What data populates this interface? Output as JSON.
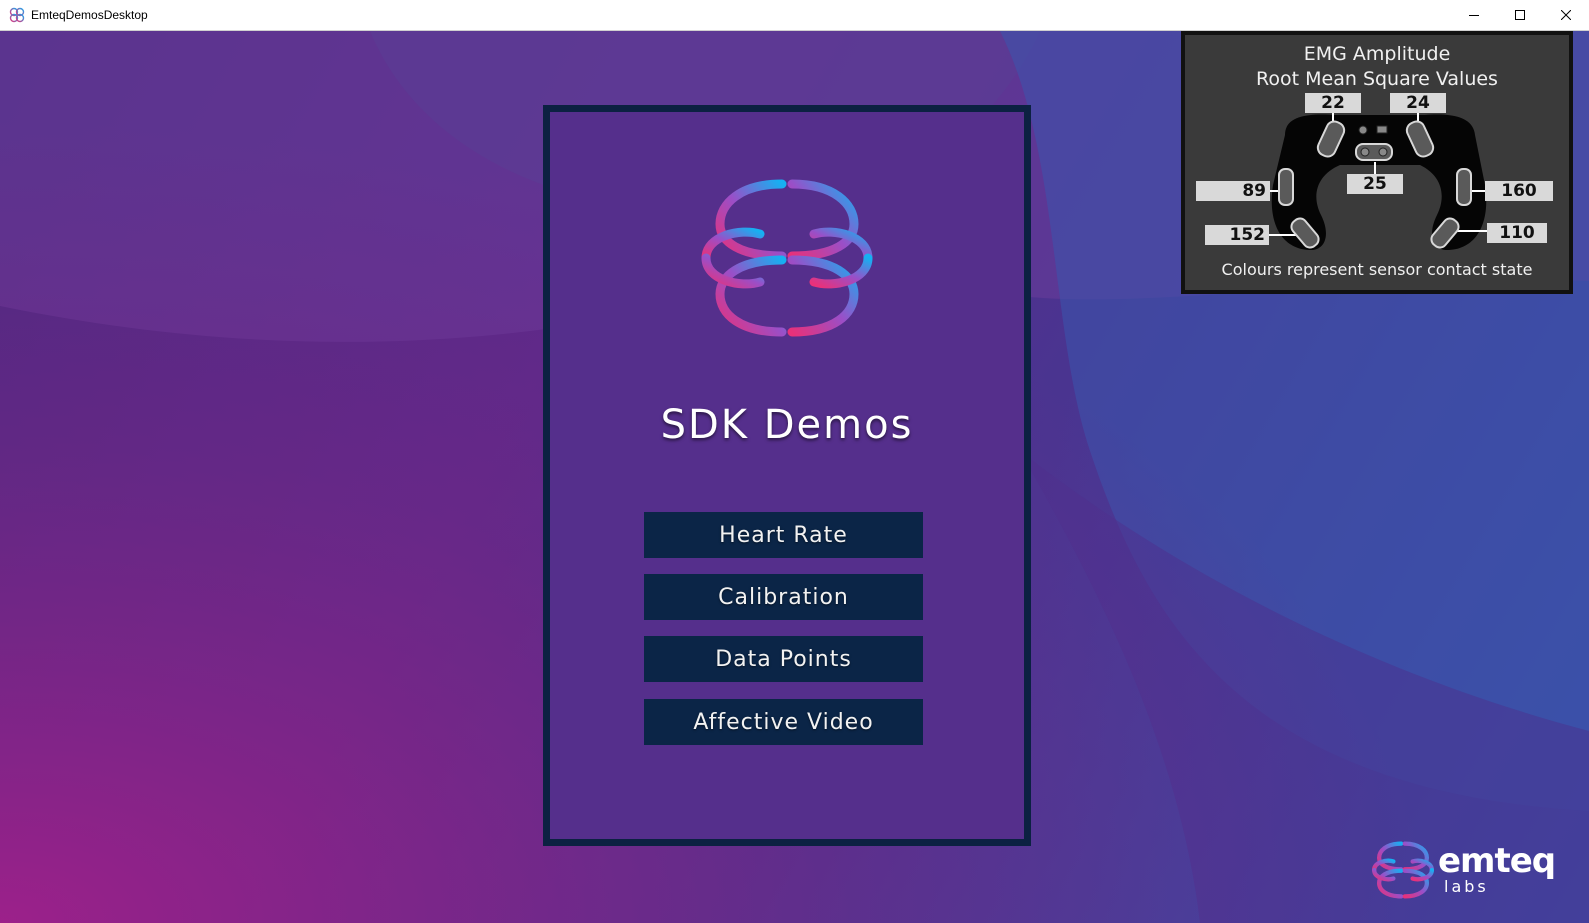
{
  "window": {
    "title": "EmteqDemosDesktop",
    "controls": {
      "minimize": "minimize",
      "maximize": "maximize",
      "close": "close"
    }
  },
  "card": {
    "title": "SDK Demos",
    "buttons": [
      {
        "label": "Heart Rate"
      },
      {
        "label": "Calibration"
      },
      {
        "label": "Data Points"
      },
      {
        "label": "Affective Video"
      }
    ]
  },
  "emg": {
    "title_line1": "EMG Amplitude",
    "title_line2": "Root Mean Square Values",
    "values": {
      "top_left": "22",
      "top_right": "24",
      "center": "25",
      "left": "89",
      "right": "160",
      "bottom_left": "152",
      "bottom_right": "110"
    },
    "caption": "Colours represent sensor contact state"
  },
  "brand": {
    "word": "emteq",
    "sub": "labs"
  },
  "colors": {
    "card_bg": "#552f8c",
    "card_border": "#0c2142",
    "button_bg": "#0b2547",
    "logo_pink": "#e8317a",
    "logo_cyan": "#1aa8f0",
    "emg_bg": "#3a3a3a"
  }
}
